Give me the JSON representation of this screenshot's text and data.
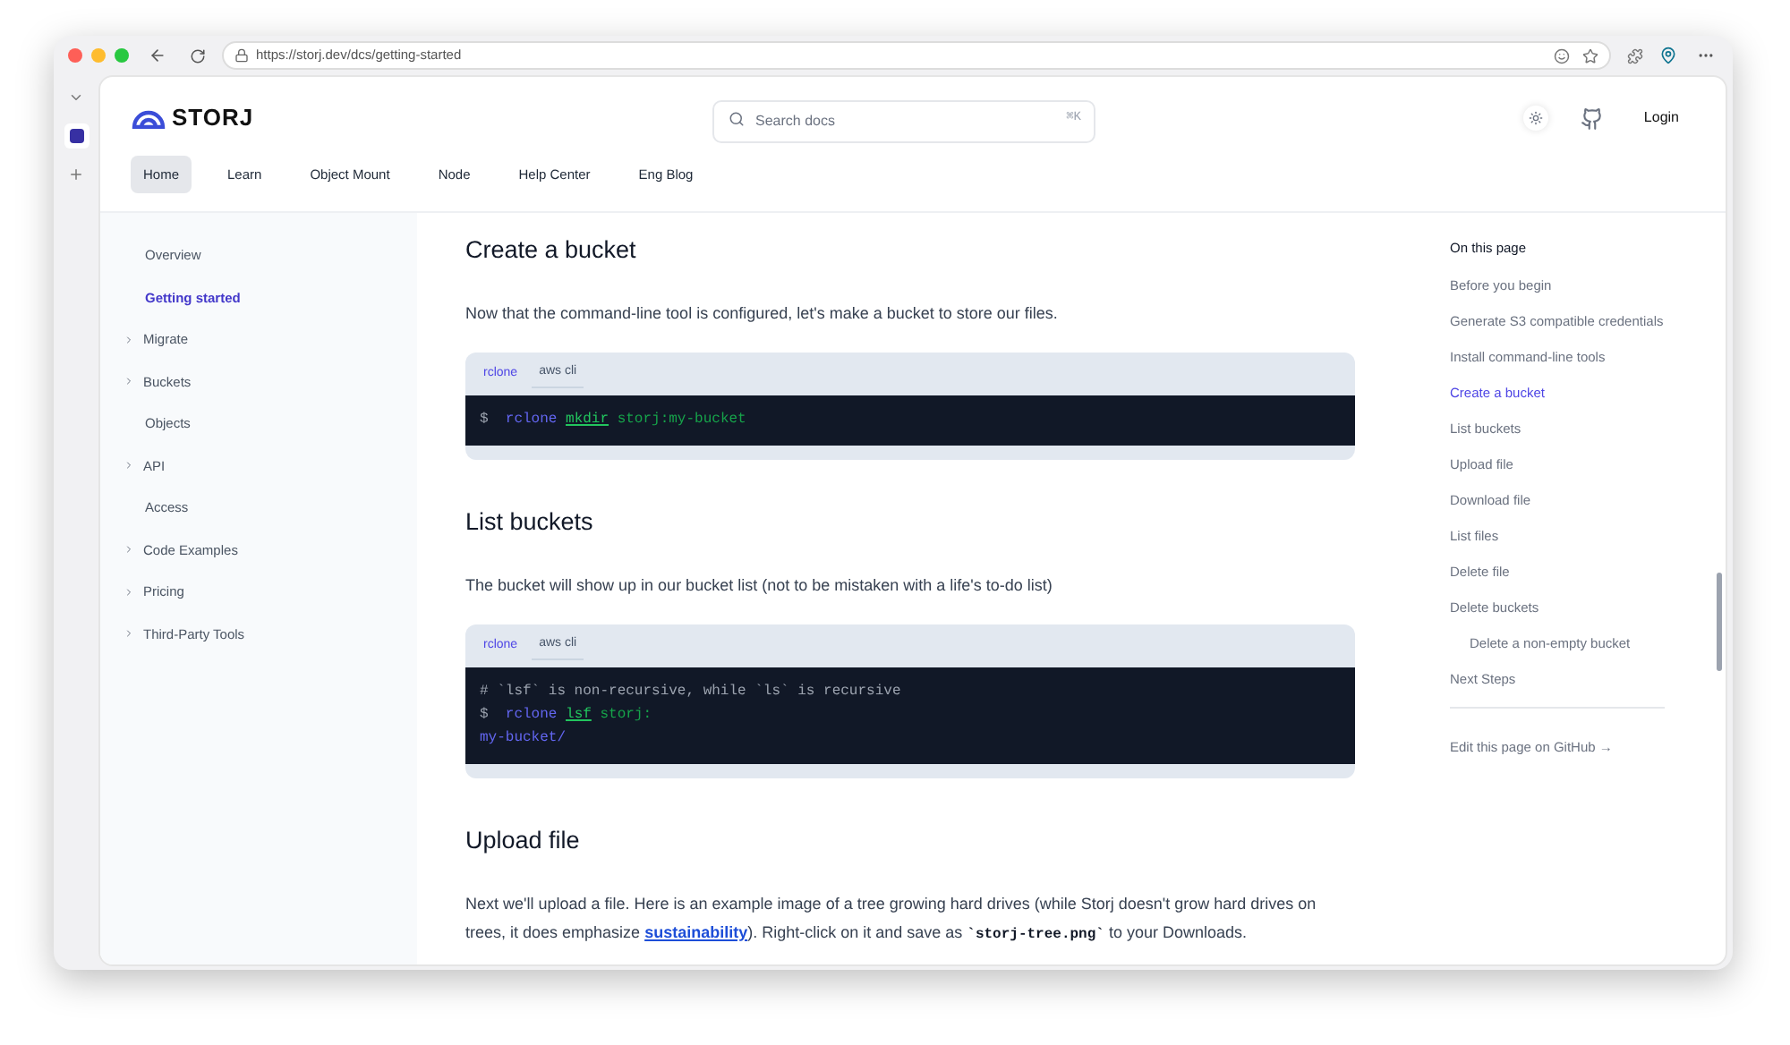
{
  "browser": {
    "url": "https://storj.dev/dcs/getting-started"
  },
  "header": {
    "logo": "STORJ",
    "search": {
      "placeholder": "Search docs",
      "shortcut": "⌘K"
    },
    "login": "Login",
    "nav": [
      {
        "label": "Home",
        "selected": true
      },
      {
        "label": "Learn",
        "selected": false
      },
      {
        "label": "Object Mount",
        "selected": false
      },
      {
        "label": "Node",
        "selected": false
      },
      {
        "label": "Help Center",
        "selected": false
      },
      {
        "label": "Eng Blog",
        "selected": false
      }
    ]
  },
  "sidebar": {
    "items": [
      {
        "label": "Overview",
        "expandable": false,
        "selected": false
      },
      {
        "label": "Getting started",
        "expandable": false,
        "selected": true
      },
      {
        "label": "Migrate",
        "expandable": true,
        "selected": false
      },
      {
        "label": "Buckets",
        "expandable": true,
        "selected": false
      },
      {
        "label": "Objects",
        "expandable": false,
        "selected": false
      },
      {
        "label": "API",
        "expandable": true,
        "selected": false
      },
      {
        "label": "Access",
        "expandable": false,
        "selected": false
      },
      {
        "label": "Code Examples",
        "expandable": true,
        "selected": false
      },
      {
        "label": "Pricing",
        "expandable": true,
        "selected": false
      },
      {
        "label": "Third-Party Tools",
        "expandable": true,
        "selected": false
      }
    ]
  },
  "content": {
    "sections": [
      {
        "heading": "Create a bucket",
        "paragraph": [
          {
            "kind": "text",
            "text": "Now that the command-line tool is configured, let's make a bucket to store our files."
          }
        ],
        "code": {
          "tabs": [
            {
              "label": "rclone",
              "selected": true
            },
            {
              "label": "aws cli",
              "selected": false
            }
          ],
          "lines": [
            [
              {
                "kind": "prompt",
                "text": "$"
              },
              {
                "kind": "command",
                "text": "rclone"
              },
              {
                "kind": "subcommand",
                "text": "mkdir"
              },
              {
                "kind": "argument",
                "text": "storj:my-bucket"
              }
            ]
          ]
        }
      },
      {
        "heading": "List buckets",
        "paragraph": [
          {
            "kind": "text",
            "text": "The bucket will show up in our bucket list (not to be mistaken with a life's to-do list)"
          }
        ],
        "code": {
          "tabs": [
            {
              "label": "rclone",
              "selected": true
            },
            {
              "label": "aws cli",
              "selected": false
            }
          ],
          "lines": [
            [
              {
                "kind": "comment",
                "text": "# `lsf` is non-recursive, while `ls` is recursive"
              }
            ],
            [
              {
                "kind": "prompt",
                "text": "$"
              },
              {
                "kind": "command",
                "text": "rclone"
              },
              {
                "kind": "subcommand",
                "text": "lsf"
              },
              {
                "kind": "argument",
                "text": "storj:"
              }
            ],
            [
              {
                "kind": "output",
                "text": "my-bucket/"
              }
            ]
          ]
        }
      },
      {
        "heading": "Upload file",
        "paragraph": [
          {
            "kind": "text",
            "text": "Next we'll upload a file. Here is an example image of a tree growing hard drives (while Storj doesn't grow hard drives on trees, it does emphasize "
          },
          {
            "kind": "link",
            "text": "sustainability"
          },
          {
            "kind": "text",
            "text": "). Right-click on it and save as "
          },
          {
            "kind": "code",
            "text": "`storj-tree.png`"
          },
          {
            "kind": "text",
            "text": " to your Downloads."
          }
        ]
      }
    ]
  },
  "toc": {
    "title": "On this page",
    "items": [
      {
        "label": "Before you begin",
        "selected": false
      },
      {
        "label": "Generate S3 compatible credentials",
        "selected": false
      },
      {
        "label": "Install command-line tools",
        "selected": false
      },
      {
        "label": "Create a bucket",
        "selected": true
      },
      {
        "label": "List buckets",
        "selected": false
      },
      {
        "label": "Upload file",
        "selected": false
      },
      {
        "label": "Download file",
        "selected": false
      },
      {
        "label": "List files",
        "selected": false
      },
      {
        "label": "Delete file",
        "selected": false
      },
      {
        "label": "Delete buckets",
        "selected": false,
        "children": [
          {
            "label": "Delete a non-empty bucket",
            "selected": false
          }
        ]
      },
      {
        "label": "Next Steps",
        "selected": false
      }
    ],
    "edit_link": "Edit this page on GitHub →"
  }
}
